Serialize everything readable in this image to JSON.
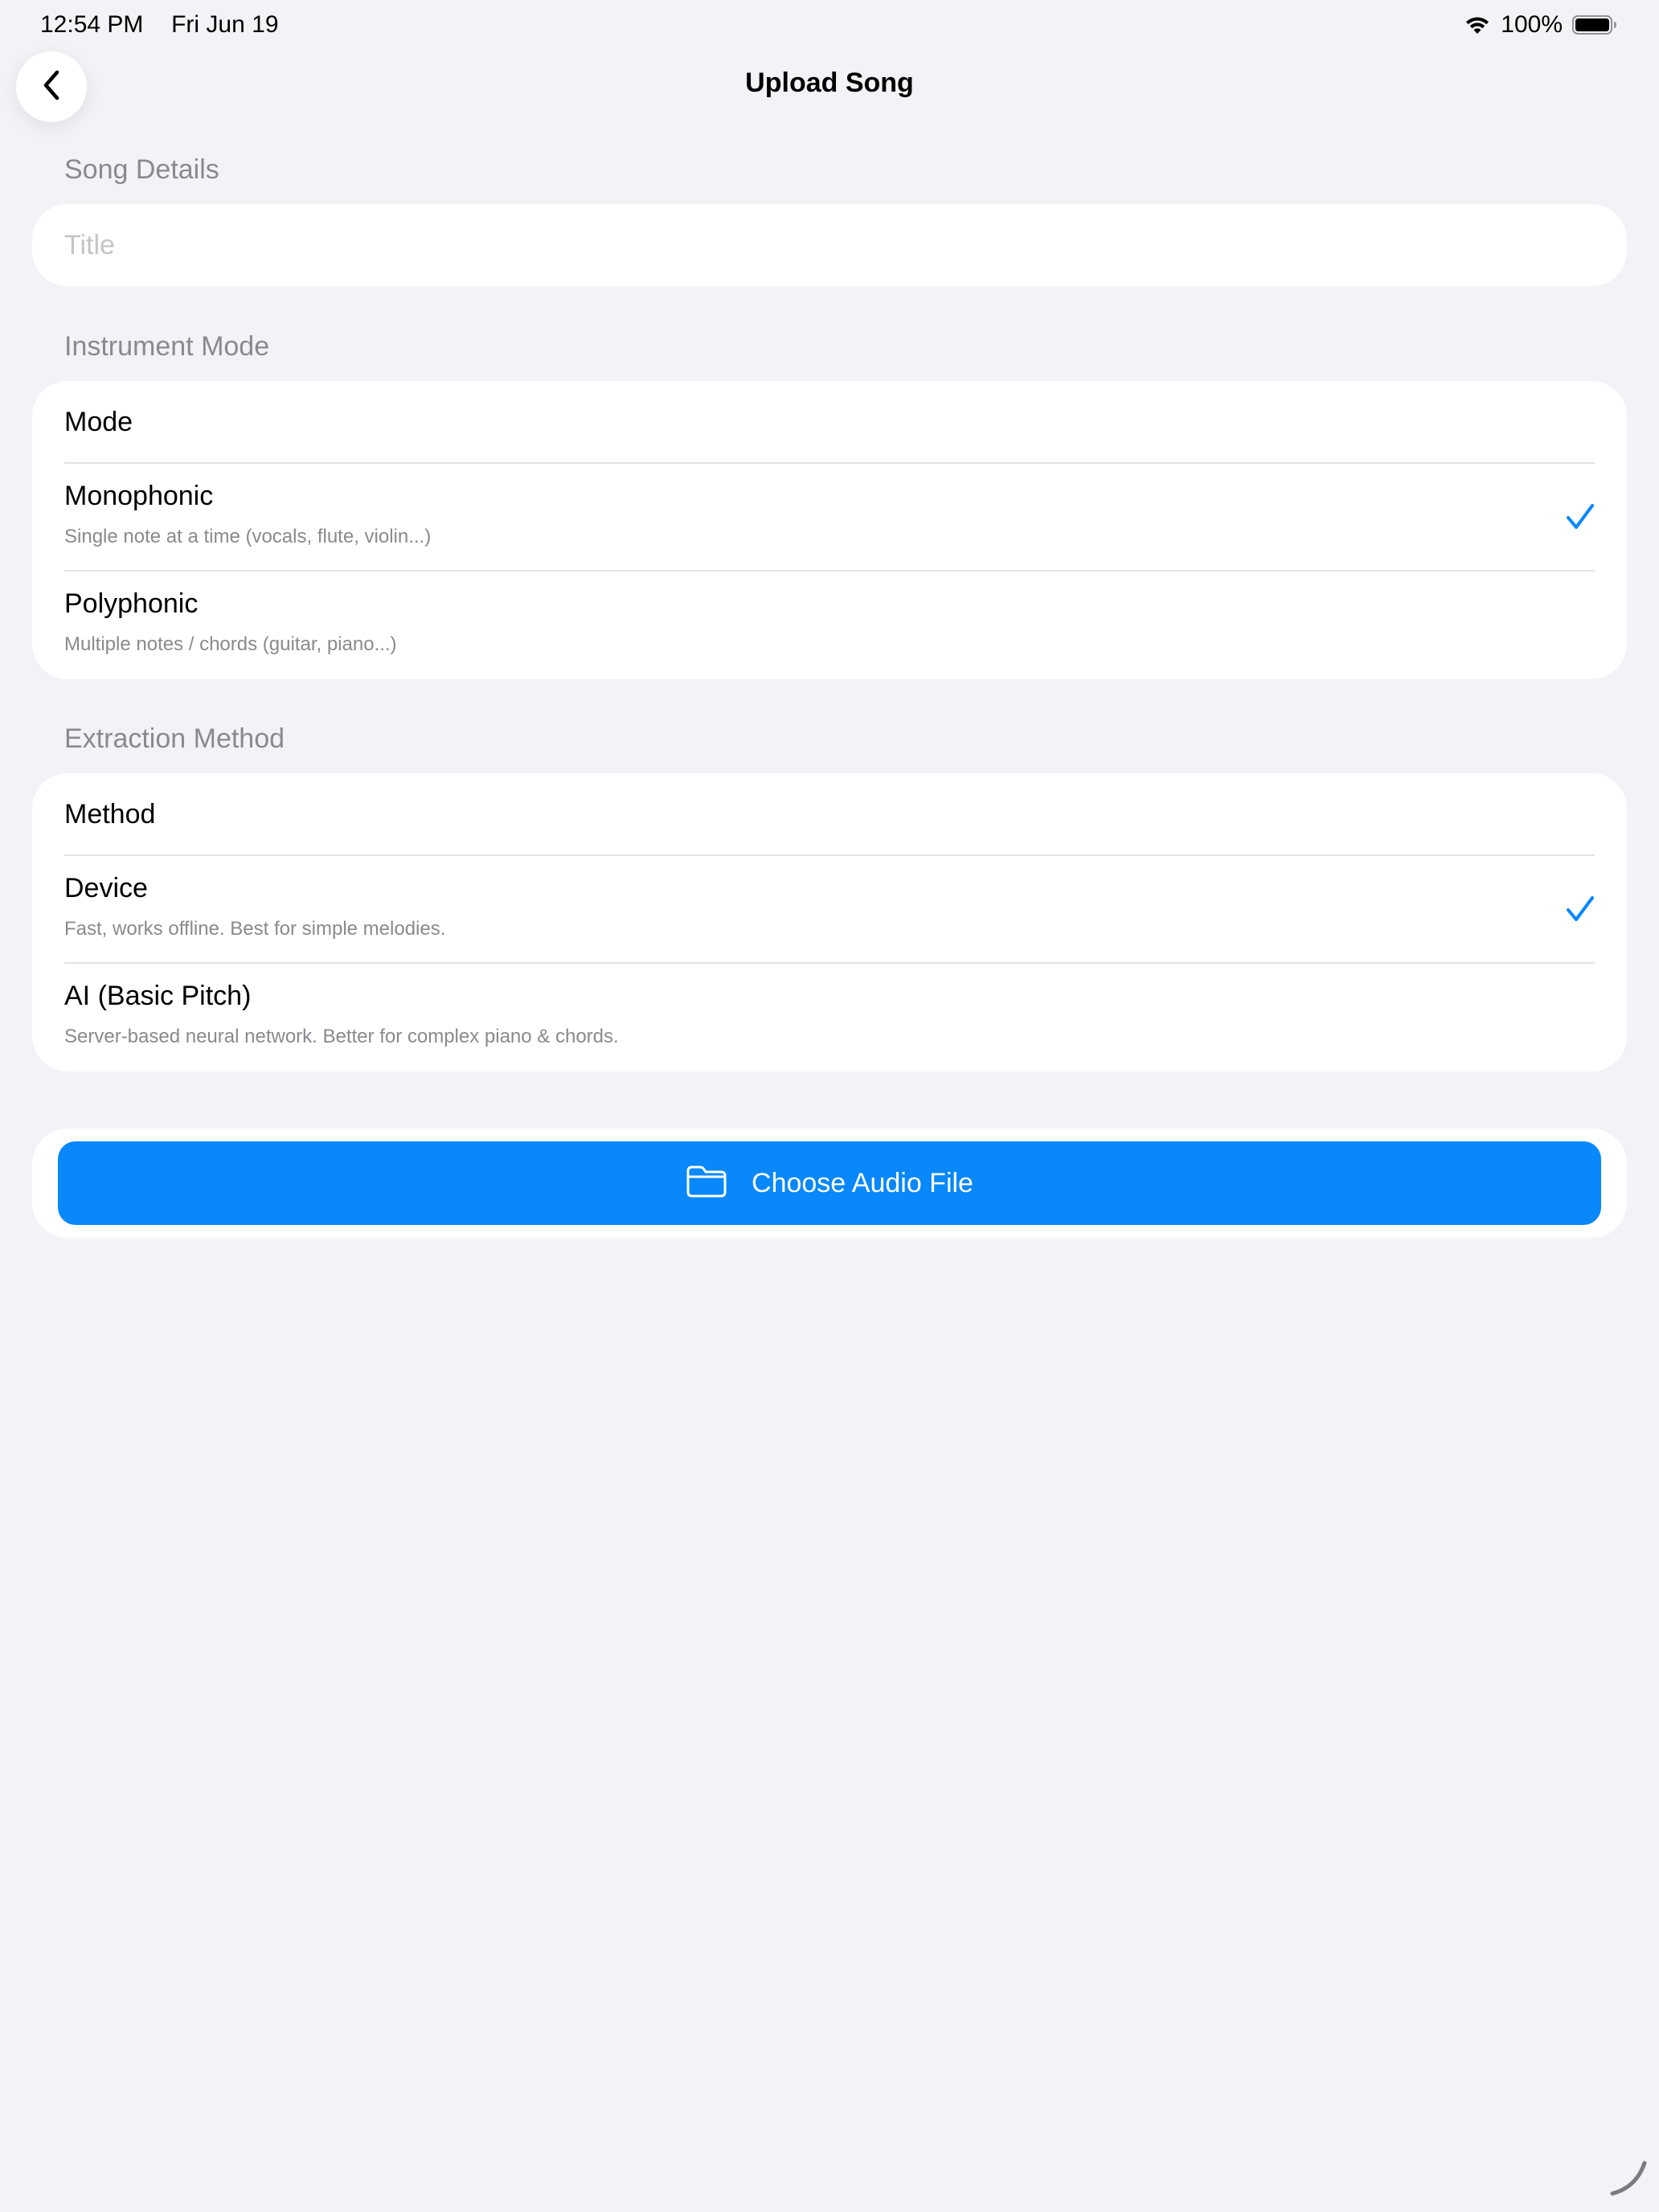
{
  "status_bar": {
    "time": "12:54 PM",
    "date": "Fri Jun 19",
    "battery_percent": "100%",
    "battery_level": 1.0
  },
  "nav": {
    "title": "Upload Song",
    "back_icon": "chevron-left-icon"
  },
  "song_details": {
    "header": "Song Details",
    "title_field": {
      "value": "",
      "placeholder": "Title"
    }
  },
  "instrument_mode": {
    "header": "Instrument Mode",
    "picker_label": "Mode",
    "options": [
      {
        "label": "Monophonic",
        "subtitle": "Single note at a time (vocals, flute, violin...)",
        "selected": true
      },
      {
        "label": "Polyphonic",
        "subtitle": "Multiple notes / chords (guitar, piano...)",
        "selected": false
      }
    ]
  },
  "extraction_method": {
    "header": "Extraction Method",
    "picker_label": "Method",
    "options": [
      {
        "label": "Device",
        "subtitle": "Fast, works offline. Best for simple melodies.",
        "selected": true
      },
      {
        "label": "AI (Basic Pitch)",
        "subtitle": "Server-based neural network. Better for complex piano & chords.",
        "selected": false
      }
    ]
  },
  "actions": {
    "choose_file_label": "Choose Audio File",
    "choose_file_icon": "folder-icon"
  },
  "colors": {
    "background": "#F2F2F7",
    "card": "#FFFFFF",
    "accent": "#0888FA",
    "secondary_text": "#8A8A8E"
  }
}
